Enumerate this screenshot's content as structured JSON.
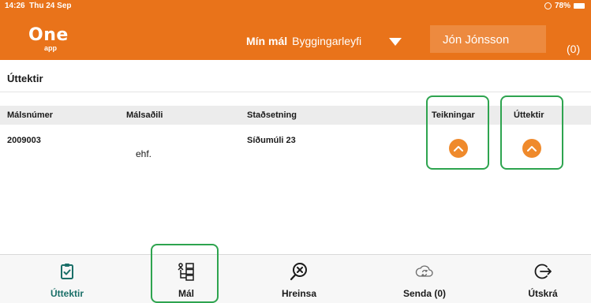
{
  "status_bar": {
    "time": "14:26",
    "date": "Thu 24 Sep",
    "battery": "78%"
  },
  "header": {
    "logo": "One",
    "logo_sub": "app",
    "crumb_bold": "Mín mál",
    "crumb_value": "Byggingarleyfi",
    "user_name": "Jón Jónsson",
    "count": "(0)"
  },
  "section_title": "Úttektir",
  "table": {
    "headers": {
      "case_number": "Málsnúmer",
      "case_party": "Málsaðili",
      "location": "Staðsetning",
      "drawings": "Teikningar",
      "inspections": "Úttektir"
    },
    "rows": [
      {
        "case_number": "2009003",
        "case_party": "ehf.",
        "location": "Síðumúli 23"
      }
    ]
  },
  "tab_bar": {
    "items": [
      {
        "label": "Úttektir",
        "icon": "clipboard-check-icon"
      },
      {
        "label": "Mál",
        "icon": "hierarchy-checklist-icon"
      },
      {
        "label": "Hreinsa",
        "icon": "search-x-icon"
      },
      {
        "label": "Senda (0)",
        "icon": "cloud-sync-icon"
      },
      {
        "label": "Útskrá",
        "icon": "logout-icon"
      }
    ]
  },
  "colors": {
    "brand": "#e9731a",
    "accent_button": "#ef8a2c",
    "active_tab": "#1a6f68",
    "highlight": "#2ea44f"
  }
}
